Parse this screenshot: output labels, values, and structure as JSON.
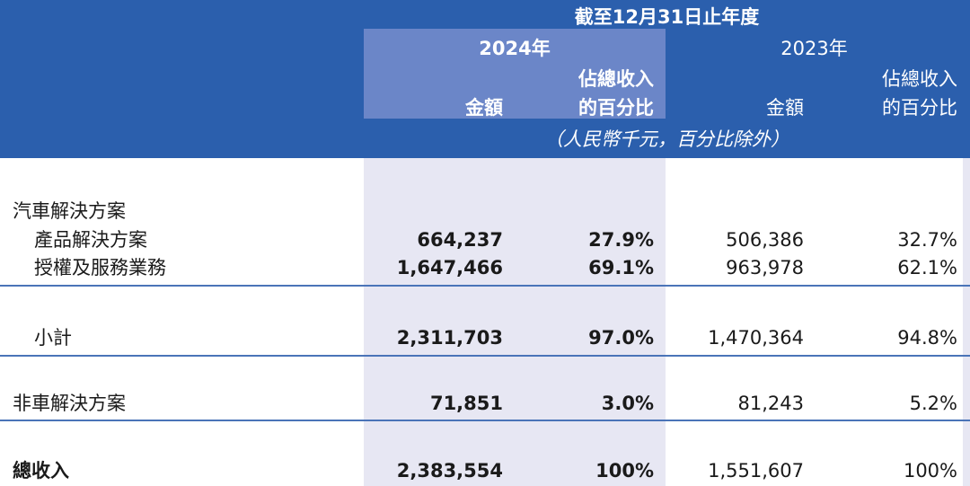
{
  "header": {
    "period": "截至12月31日止年度",
    "year_2024": "2024年",
    "year_2023": "2023年",
    "amount": "金額",
    "pct_line1": "佔總收入",
    "pct_line2": "的百分比",
    "unit_note": "（人民幣千元，百分比除外）"
  },
  "rows": [
    {
      "label": "汽車解決方案",
      "a2024": "",
      "p2024": "",
      "a2023": "",
      "p2023": ""
    },
    {
      "label": "產品解決方案",
      "a2024": "664,237",
      "p2024": "27.9%",
      "a2023": "506,386",
      "p2023": "32.7%"
    },
    {
      "label": "授權及服務業務",
      "a2024": "1,647,466",
      "p2024": "69.1%",
      "a2023": "963,978",
      "p2023": "62.1%"
    },
    {
      "label": "小計",
      "a2024": "2,311,703",
      "p2024": "97.0%",
      "a2023": "1,470,364",
      "p2023": "94.8%"
    },
    {
      "label": "非車解決方案",
      "a2024": "71,851",
      "p2024": "3.0%",
      "a2023": "81,243",
      "p2023": "5.2%"
    },
    {
      "label": "總收入",
      "a2024": "2,383,554",
      "p2024": "100%",
      "a2023": "1,551,607",
      "p2023": "100%"
    }
  ],
  "colors": {
    "header_bg": "#2b5fad",
    "highlight_bg": "#6b86c8",
    "shade_bg": "#e7e7f3",
    "rule": "#4a74b8"
  }
}
